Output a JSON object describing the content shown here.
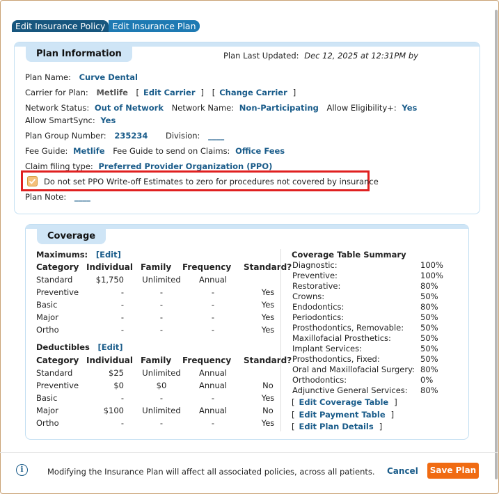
{
  "tabs": [
    "Edit Insurance Policy",
    "Edit Insurance Plan"
  ],
  "plan_info": {
    "section_title": "Plan Information",
    "last_updated_label": "Plan Last Updated:",
    "last_updated_value": "Dec 12, 2025 at 12:31PM by",
    "plan_name_label": "Plan Name:",
    "plan_name": "Curve Dental",
    "carrier_label": "Carrier for Plan:",
    "carrier": "Metlife",
    "edit_carrier": "Edit Carrier",
    "change_carrier": "Change Carrier",
    "network_status_label": "Network Status:",
    "network_status": "Out of Network",
    "network_name_label": "Network Name:",
    "network_name": "Non-Participating",
    "allow_eligibility_label": "Allow Eligibility+:",
    "allow_eligibility": "Yes",
    "allow_smartsync_label": "Allow SmartSync:",
    "allow_smartsync": "Yes",
    "group_number_label": "Plan Group Number:",
    "group_number": "235234",
    "division_label": "Division:",
    "division": "____",
    "fee_guide_label": "Fee Guide:",
    "fee_guide": "Metlife",
    "fee_guide_claims_label": "Fee Guide to send on Claims:",
    "fee_guide_claims": "Office Fees",
    "claim_type_label": "Claim filing type:",
    "claim_type": "Preferred Provider Organization (PPO)",
    "ppo_checkbox_label": "Do not set PPO Write-off Estimates to zero for procedures not covered by insurance",
    "plan_note_label": "Plan Note:",
    "plan_note": "____"
  },
  "coverage": {
    "section_title": "Coverage",
    "maximums_label": "Maximums:",
    "deductibles_label": "Deductibles",
    "edit_label": "[Edit]",
    "headers": [
      "Category",
      "Individual",
      "Family",
      "Frequency",
      "Standard?"
    ],
    "maximums": [
      [
        "Standard",
        "$1,750",
        "Unlimited",
        "Annual",
        ""
      ],
      [
        "Preventive",
        "-",
        "-",
        "-",
        "Yes"
      ],
      [
        "Basic",
        "-",
        "-",
        "-",
        "Yes"
      ],
      [
        "Major",
        "-",
        "-",
        "-",
        "Yes"
      ],
      [
        "Ortho",
        "-",
        "-",
        "-",
        "Yes"
      ]
    ],
    "deductibles": [
      [
        "Standard",
        "$25",
        "Unlimited",
        "Annual",
        ""
      ],
      [
        "Preventive",
        "$0",
        "$0",
        "Annual",
        "No"
      ],
      [
        "Basic",
        "-",
        "-",
        "-",
        "Yes"
      ],
      [
        "Major",
        "$100",
        "Unlimited",
        "Annual",
        "No"
      ],
      [
        "Ortho",
        "-",
        "-",
        "-",
        "Yes"
      ]
    ],
    "summary_title": "Coverage Table Summary",
    "summary": [
      [
        "Diagnostic:",
        "100%"
      ],
      [
        "Preventive:",
        "100%"
      ],
      [
        "Restorative:",
        "80%"
      ],
      [
        "Crowns:",
        "50%"
      ],
      [
        "Endodontics:",
        "80%"
      ],
      [
        "Periodontics:",
        "50%"
      ],
      [
        "Prosthodontics, Removable:",
        "50%"
      ],
      [
        "Maxillofacial Prosthetics:",
        "50%"
      ],
      [
        "Implant Services:",
        "50%"
      ],
      [
        "Prosthodontics, Fixed:",
        "50%"
      ],
      [
        "Oral and Maxillofacial Surgery:",
        "80%"
      ],
      [
        "Orthodontics:",
        "0%"
      ],
      [
        "Adjunctive General Services:",
        "80%"
      ]
    ],
    "edit_coverage_table": "Edit Coverage Table",
    "edit_payment_table": "Edit Payment Table",
    "edit_plan_details": "Edit Plan Details"
  },
  "footer": {
    "info_icon_glyph": "i",
    "message": "Modifying the Insurance Plan will affect all associated policies, across all patients.",
    "cancel_label": "Cancel",
    "save_label": "Save Plan"
  },
  "colors": {
    "tab_active": "#17567e",
    "tab_inactive": "#1e7ab3",
    "link": "#1a5c8a",
    "panel_header": "#cfe5f6",
    "highlight_border": "#e02020",
    "save_button": "#f06b12"
  }
}
